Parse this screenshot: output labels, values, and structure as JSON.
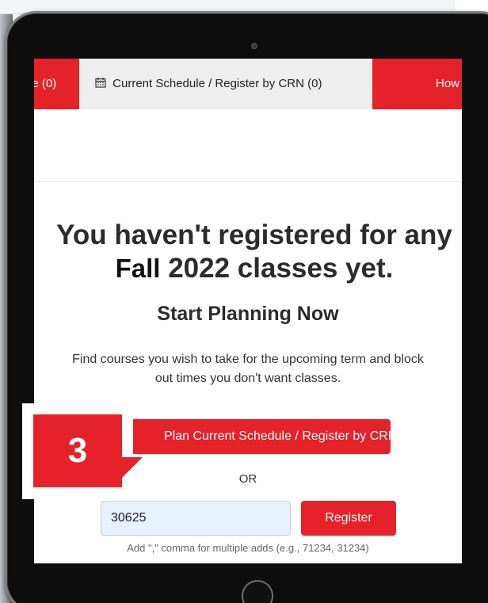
{
  "nav": {
    "left_tab_label": "le (0)",
    "active_tab_label": "Current Schedule / Register by CRN (0)",
    "right_tab_label": "How"
  },
  "main": {
    "headline_line1": "You haven't registered for any",
    "term_word": "Fall",
    "headline_line2_rest": " 2022 classes yet.",
    "subheading": "Start Planning Now",
    "description": "Find courses you wish to take for the upcoming term and block out times you don't want classes.",
    "plan_button_label": "Plan Current Schedule / Register by CRN",
    "or_label": "OR",
    "crn_input_value": "30625",
    "register_button_label": "Register",
    "hint": "Add \",\" comma for multiple adds (e.g., 71234, 31234)"
  },
  "callout": {
    "step_number": "3"
  },
  "icons": {
    "calendar": "calendar-icon"
  },
  "colors": {
    "accent_red": "#e5222a",
    "input_bg": "#e8f0fe"
  }
}
